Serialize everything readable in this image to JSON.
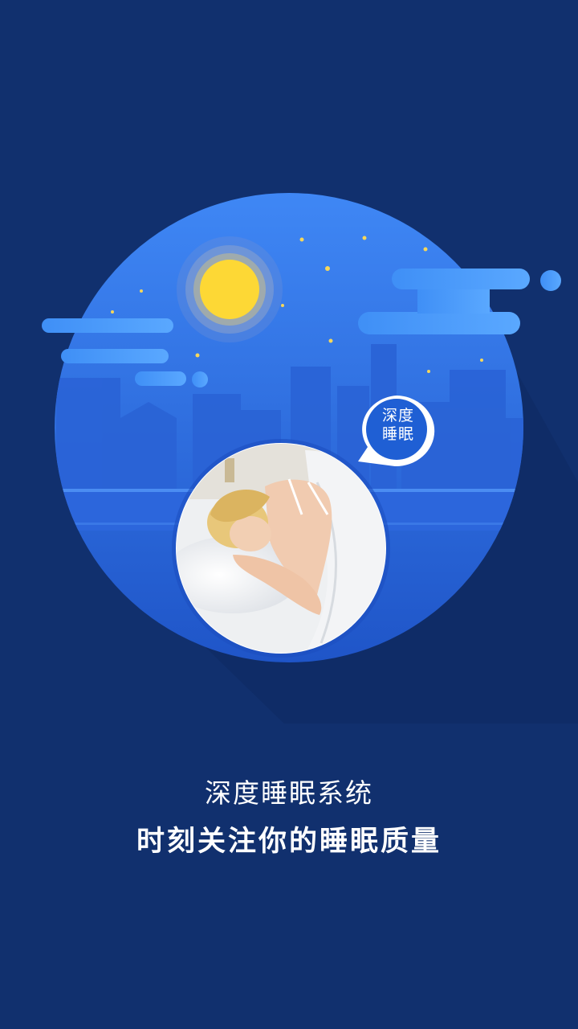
{
  "splash": {
    "badge_line1": "深度",
    "badge_line2": "睡眠",
    "title": "深度睡眠系统",
    "subtitle": "时刻关注你的睡眠质量"
  },
  "colors": {
    "background": "#11306e",
    "circle": "#2f6fe0",
    "sun": "#fdd835",
    "accent": "#3b86f0"
  }
}
